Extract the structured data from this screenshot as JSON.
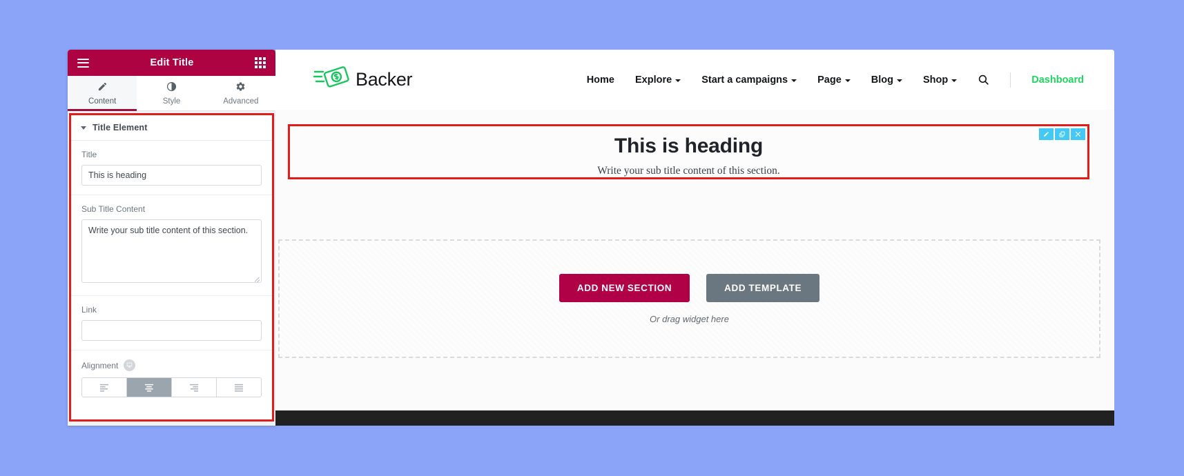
{
  "panel": {
    "title": "Edit Title",
    "menu_icon": "hamburger-icon",
    "apps_icon": "grid-apps-icon",
    "tabs": [
      {
        "label": "Content",
        "icon": "pencil-icon",
        "active": true
      },
      {
        "label": "Style",
        "icon": "contrast-icon",
        "active": false
      },
      {
        "label": "Advanced",
        "icon": "gear-icon",
        "active": false
      }
    ],
    "section": {
      "title": "Title Element",
      "collapse_icon": "caret-down-icon"
    },
    "fields": {
      "title_label": "Title",
      "title_value": "This is heading",
      "subtitle_label": "Sub Title Content",
      "subtitle_value": "Write your sub title content of this section.",
      "link_label": "Link",
      "link_value": "",
      "link_placeholder": "",
      "alignment_label": "Alignment",
      "responsive_icon": "desktop-monitor-icon",
      "alignment_options": [
        {
          "name": "align-left",
          "selected": false
        },
        {
          "name": "align-center",
          "selected": true
        },
        {
          "name": "align-right",
          "selected": false
        },
        {
          "name": "align-justify",
          "selected": false
        }
      ]
    },
    "collapse_handle": "‹"
  },
  "site": {
    "brand": {
      "name": "Backer",
      "logo_icon": "flying-money-icon"
    },
    "nav": [
      {
        "label": "Home",
        "has_dropdown": false
      },
      {
        "label": "Explore",
        "has_dropdown": true
      },
      {
        "label": "Start a campaigns",
        "has_dropdown": true
      },
      {
        "label": "Page",
        "has_dropdown": true
      },
      {
        "label": "Blog",
        "has_dropdown": true
      },
      {
        "label": "Shop",
        "has_dropdown": true
      }
    ],
    "search_icon": "search-icon",
    "dashboard_label": "Dashboard"
  },
  "widget": {
    "heading": "This is heading",
    "subheading": "Write your sub title content of this section.",
    "toolbar": [
      {
        "name": "edit-widget",
        "icon": "pencil-icon"
      },
      {
        "name": "duplicate-widget",
        "icon": "duplicate-icon"
      },
      {
        "name": "delete-widget",
        "icon": "close-x-icon"
      }
    ]
  },
  "dropzone": {
    "add_section_label": "ADD NEW SECTION",
    "add_template_label": "ADD TEMPLATE",
    "hint": "Or drag widget here"
  },
  "colors": {
    "panel_header": "#ae0343",
    "accent_crimson": "#b00046",
    "selection_red": "#e21b1b",
    "dashboard_green": "#1fd660",
    "toolbar_blue": "#44c8f5",
    "page_background": "#8ba4f7"
  }
}
